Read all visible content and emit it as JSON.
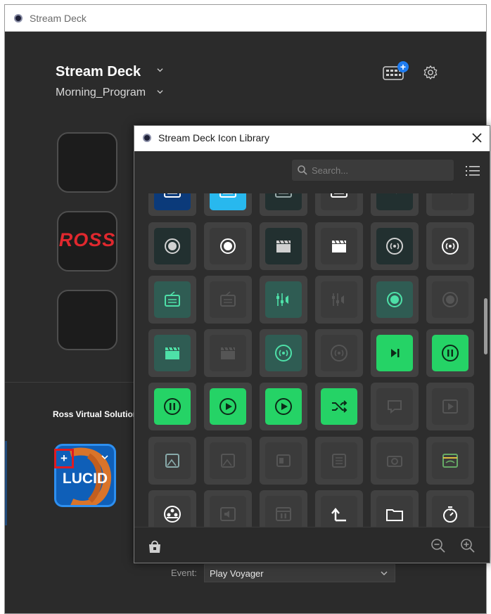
{
  "window": {
    "title": "Stream Deck"
  },
  "header": {
    "device_name": "Stream Deck",
    "profile_name": "Morning_Program",
    "hardware_badge": "+"
  },
  "deck_keys": [
    {
      "label": ""
    },
    {
      "label": "ROSS"
    },
    {
      "label": ""
    }
  ],
  "actions_panel": {
    "category": "Ross Virtual Solutions",
    "action_label": "LUCID",
    "add_badge": "+"
  },
  "inspector": {
    "event_label": "Event:",
    "event_value": "Play Voyager"
  },
  "icon_library": {
    "title": "Stream Deck Icon Library",
    "search_placeholder": "Search...",
    "rows": [
      [
        {
          "icon": "keyboard-icon",
          "bg": "#0b3a7a",
          "fg": "#ffffff"
        },
        {
          "icon": "keyboard-icon",
          "bg": "#28b8ee",
          "fg": "#ffffff"
        },
        {
          "icon": "keyboard-icon",
          "bg": "#223030",
          "fg": "#9aa"
        },
        {
          "icon": "keyboard-icon",
          "bg": "#3a3a3a",
          "fg": "#ffffff"
        },
        {
          "icon": "media-icon",
          "bg": "#223030",
          "fg": "#9aa"
        },
        {
          "icon": "media-icon",
          "bg": "#3a3a3a",
          "fg": "#ddd"
        }
      ],
      [
        {
          "icon": "record-icon",
          "bg": "#223030",
          "fg": "#d0d0d0"
        },
        {
          "icon": "record-icon",
          "bg": "#3a3a3a",
          "fg": "#ffffff"
        },
        {
          "icon": "clapper-icon",
          "bg": "#223030",
          "fg": "#d0d0d0"
        },
        {
          "icon": "clapper-icon",
          "bg": "#3a3a3a",
          "fg": "#ffffff"
        },
        {
          "icon": "broadcast-icon",
          "bg": "#223030",
          "fg": "#d0d0d0"
        },
        {
          "icon": "broadcast-icon",
          "bg": "#3a3a3a",
          "fg": "#ffffff"
        }
      ],
      [
        {
          "icon": "radio-icon",
          "bg": "#2f5c53",
          "fg": "#4ee0a8"
        },
        {
          "icon": "radio-icon",
          "bg": "#3b3b3b",
          "fg": "#555"
        },
        {
          "icon": "mixer-icon",
          "bg": "#2f5c53",
          "fg": "#4ee0a8"
        },
        {
          "icon": "mixer-icon",
          "bg": "#3b3b3b",
          "fg": "#555"
        },
        {
          "icon": "record-icon",
          "bg": "#2f5c53",
          "fg": "#4ee0a8"
        },
        {
          "icon": "record-icon",
          "bg": "#3b3b3b",
          "fg": "#555"
        }
      ],
      [
        {
          "icon": "clapper-icon",
          "bg": "#2f5c53",
          "fg": "#4ee0a8"
        },
        {
          "icon": "clapper-icon",
          "bg": "#3b3b3b",
          "fg": "#555"
        },
        {
          "icon": "broadcast-icon",
          "bg": "#2f5c53",
          "fg": "#4ee0a8"
        },
        {
          "icon": "broadcast-icon",
          "bg": "#3b3b3b",
          "fg": "#555"
        },
        {
          "icon": "play-next-icon",
          "bg": "#25d366",
          "fg": "#0c2a18"
        },
        {
          "icon": "pause-circle-icon",
          "bg": "#25d366",
          "fg": "#0c2a18"
        }
      ],
      [
        {
          "icon": "pause-circle-icon",
          "bg": "#25d366",
          "fg": "#0c2a18"
        },
        {
          "icon": "play-circle-icon",
          "bg": "#25d366",
          "fg": "#0c2a18"
        },
        {
          "icon": "play-circle-icon",
          "bg": "#25d366",
          "fg": "#0c2a18"
        },
        {
          "icon": "shuffle-icon",
          "bg": "#25d366",
          "fg": "#0c2a18"
        },
        {
          "icon": "chat-icon",
          "bg": "#3b3b3b",
          "fg": "#555"
        },
        {
          "icon": "play-box-icon",
          "bg": "#3b3b3b",
          "fg": "#555"
        }
      ],
      [
        {
          "icon": "image-icon",
          "bg": "#3b3b3b",
          "fg": "#8aa"
        },
        {
          "icon": "image-icon",
          "bg": "#3b3b3b",
          "fg": "#555"
        },
        {
          "icon": "video-icon",
          "bg": "#3b3b3b",
          "fg": "#555"
        },
        {
          "icon": "list-icon",
          "bg": "#3b3b3b",
          "fg": "#555"
        },
        {
          "icon": "camera-icon",
          "bg": "#3b3b3b",
          "fg": "#555"
        },
        {
          "icon": "window-icon",
          "bg": "#3b3b3b",
          "fg": "#6a6"
        }
      ],
      [
        {
          "icon": "film-reel-icon",
          "bg": "#3b3b3b",
          "fg": "#ffffff"
        },
        {
          "icon": "volume-icon",
          "bg": "#3b3b3b",
          "fg": "#555"
        },
        {
          "icon": "pause-window-icon",
          "bg": "#3b3b3b",
          "fg": "#555"
        },
        {
          "icon": "folder-up-icon",
          "bg": "#3b3b3b",
          "fg": "#ffffff"
        },
        {
          "icon": "folder-icon",
          "bg": "#3b3b3b",
          "fg": "#ffffff"
        },
        {
          "icon": "timer-icon",
          "bg": "#3b3b3b",
          "fg": "#ffffff"
        }
      ]
    ]
  }
}
